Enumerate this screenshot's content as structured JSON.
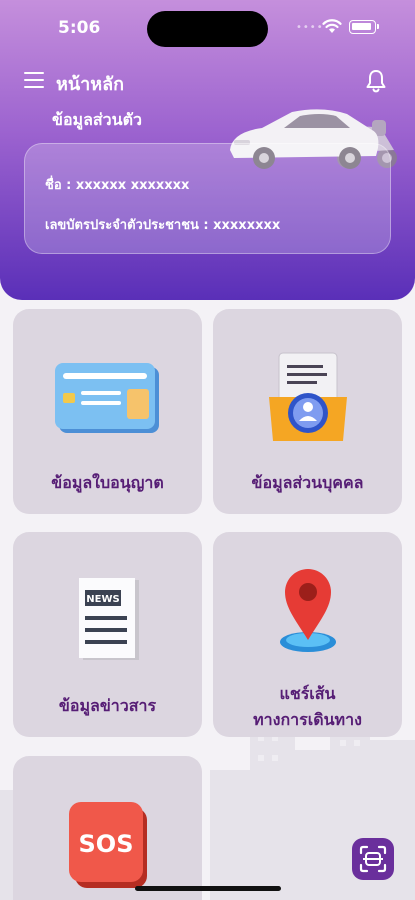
{
  "status_bar": {
    "time": "5:06"
  },
  "header": {
    "title": "หน้าหลัก",
    "section_title": "ข้อมูลส่วนตัว",
    "profile": {
      "name_line": "ชื่อ : xxxxxx xxxxxxx",
      "id_line": "เลขบัตรประจำตัวประชาชน : xxxxxxxx"
    }
  },
  "menu": {
    "license_label": "ข้อมูลใบอนุญาต",
    "personal_label": "ข้อมูลส่วนบุคคล",
    "news_label": "ข้อมูลข่าวสาร",
    "share_route_label_1": "แชร์เส้น",
    "share_route_label_2": "ทางการเดินทาง",
    "sos_text": "SOS",
    "news_badge": "NEWS"
  },
  "icons": {
    "menu": "hamburger-menu-icon",
    "bell": "bell-icon",
    "scan": "qr-scan-icon"
  },
  "colors": {
    "header_top": "#c58fdc",
    "header_bottom": "#5a2fb8",
    "tile_bg": "#dcd6e0",
    "tile_label": "#561d75",
    "scan_button": "#6a2f9c"
  }
}
